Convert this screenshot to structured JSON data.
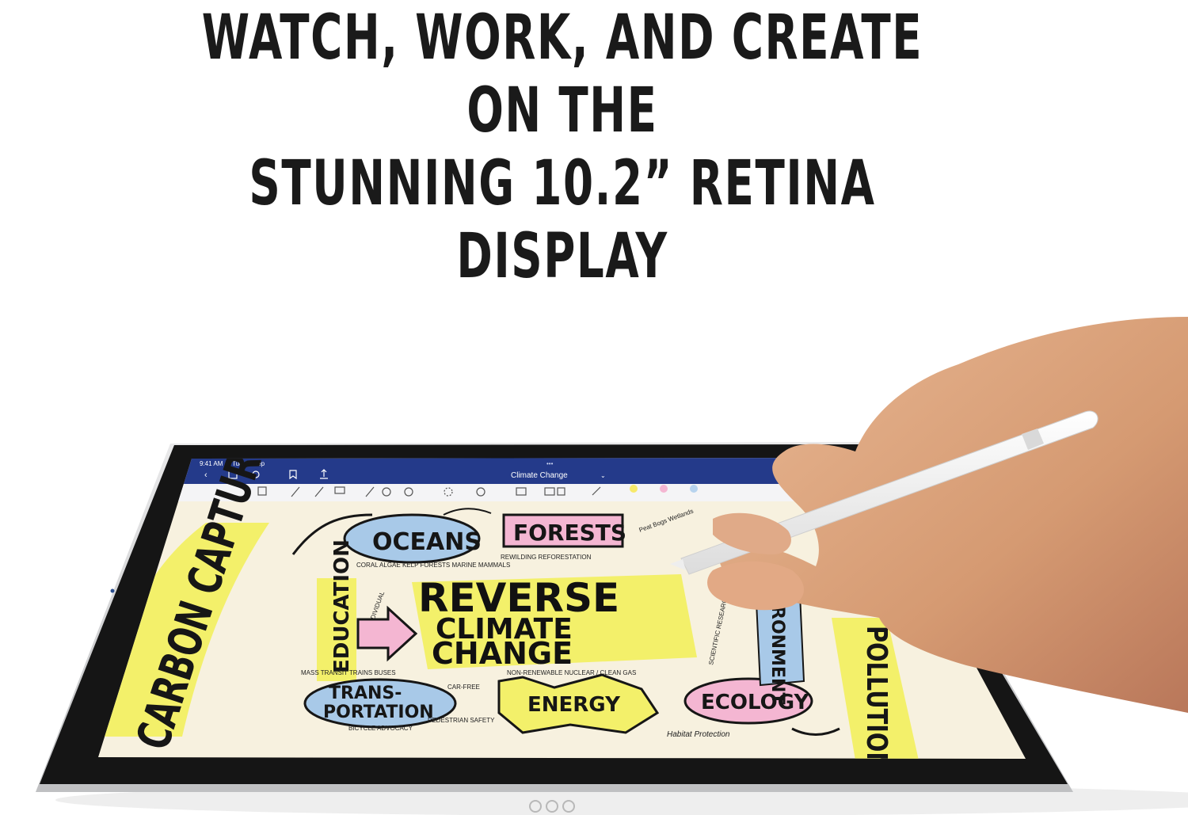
{
  "headline": {
    "line1": "WATCH, WORK, AND CREATE ON THE",
    "line2": "STUNNING 10.2” RETINA DISPLAY"
  },
  "status_bar": {
    "time": "9:41 AM",
    "date": "Tue 14 Sep"
  },
  "app": {
    "doc_title": "Climate Change",
    "more_dots": "•••"
  },
  "toolbar": {
    "colors": [
      "#f7e96a",
      "#f4b6d2",
      "#b7d3ee",
      "#222222"
    ]
  },
  "sketch": {
    "center_1": "REVERSE",
    "center_2": "CLIMATE",
    "center_3": "CHANGE",
    "oceans": "OCEANS",
    "oceans_sub": "CORAL ALGAE KELP FORESTS MARINE MAMMALS",
    "forests": "FORESTS",
    "forests_sub": "REWILDING REFORESTATION",
    "carbon": "CARBON CAPTURE",
    "education": "EDUCATION",
    "individual": "INDIVIDUAL",
    "transport_1": "TRANS-",
    "transport_2": "PORTATION",
    "mass_transit": "MASS TRANSIT TRAINS BUSES",
    "car_free": "CAR-FREE",
    "bicycle": "BICYCLE ADVOCACY",
    "pedestrian": "PEDESTRIAN SAFETY",
    "energy": "ENERGY",
    "nonrenewable": "NON-RENEWABLE NUCLEAR / CLEAN GAS",
    "ecology": "ECOLOGY",
    "habitat": "Habitat Protection",
    "scientific": "SCIENTIFIC RESEARCH INVESTMENT",
    "environment": "RONMENT",
    "peat": "Peat Bogs Wetlands",
    "right_edge": "POLLUTION"
  }
}
